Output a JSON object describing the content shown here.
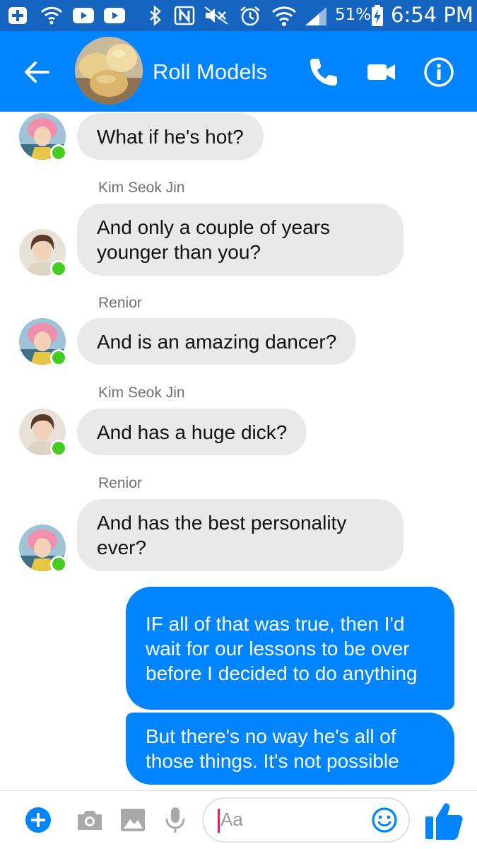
{
  "status_bar": {
    "battery": "51%",
    "time": "6:54 PM",
    "icons": [
      "add-box-icon",
      "wifi-calling-icon",
      "youtube-icon",
      "youtube-icon",
      "bluetooth-icon",
      "nfc-icon",
      "mute-icon",
      "alarm-icon",
      "wifi-icon",
      "signal-icon",
      "battery-charging-icon"
    ]
  },
  "header": {
    "title": "Roll Models",
    "icons": [
      "back-arrow-icon",
      "phone-icon",
      "video-camera-icon",
      "info-icon"
    ]
  },
  "messages": [
    {
      "sender": "",
      "text": "What if he's hot?",
      "direction": "incoming",
      "avatar": "pink-hair"
    },
    {
      "sender": "Kim Seok Jin",
      "text": "And only a couple of years younger than you?",
      "direction": "incoming",
      "avatar": "brown-hair"
    },
    {
      "sender": "Renior",
      "text": "And is an amazing dancer?",
      "direction": "incoming",
      "avatar": "pink-hair"
    },
    {
      "sender": "Kim Seok Jin",
      "text": "And has a huge dick?",
      "direction": "incoming",
      "avatar": "brown-hair"
    },
    {
      "sender": "Renior",
      "text": "And has the best personality ever?",
      "direction": "incoming",
      "avatar": "pink-hair"
    },
    {
      "sender": "",
      "text": "IF all of that was true, then I'd wait for our lessons to be over before I decided to do anything",
      "direction": "outgoing"
    },
    {
      "sender": "",
      "text": "But there's no way he's all of those things. It's not possible",
      "direction": "outgoing"
    }
  ],
  "composer": {
    "placeholder": "Aa",
    "icons": [
      "add-icon",
      "camera-icon",
      "gallery-icon",
      "microphone-icon",
      "emoji-icon",
      "thumbs-up-icon"
    ]
  },
  "colors": {
    "status_bar": "#1565c0",
    "brand": "#0084ff",
    "incoming_bubble": "#e9e9e9",
    "online": "#44cc22"
  }
}
